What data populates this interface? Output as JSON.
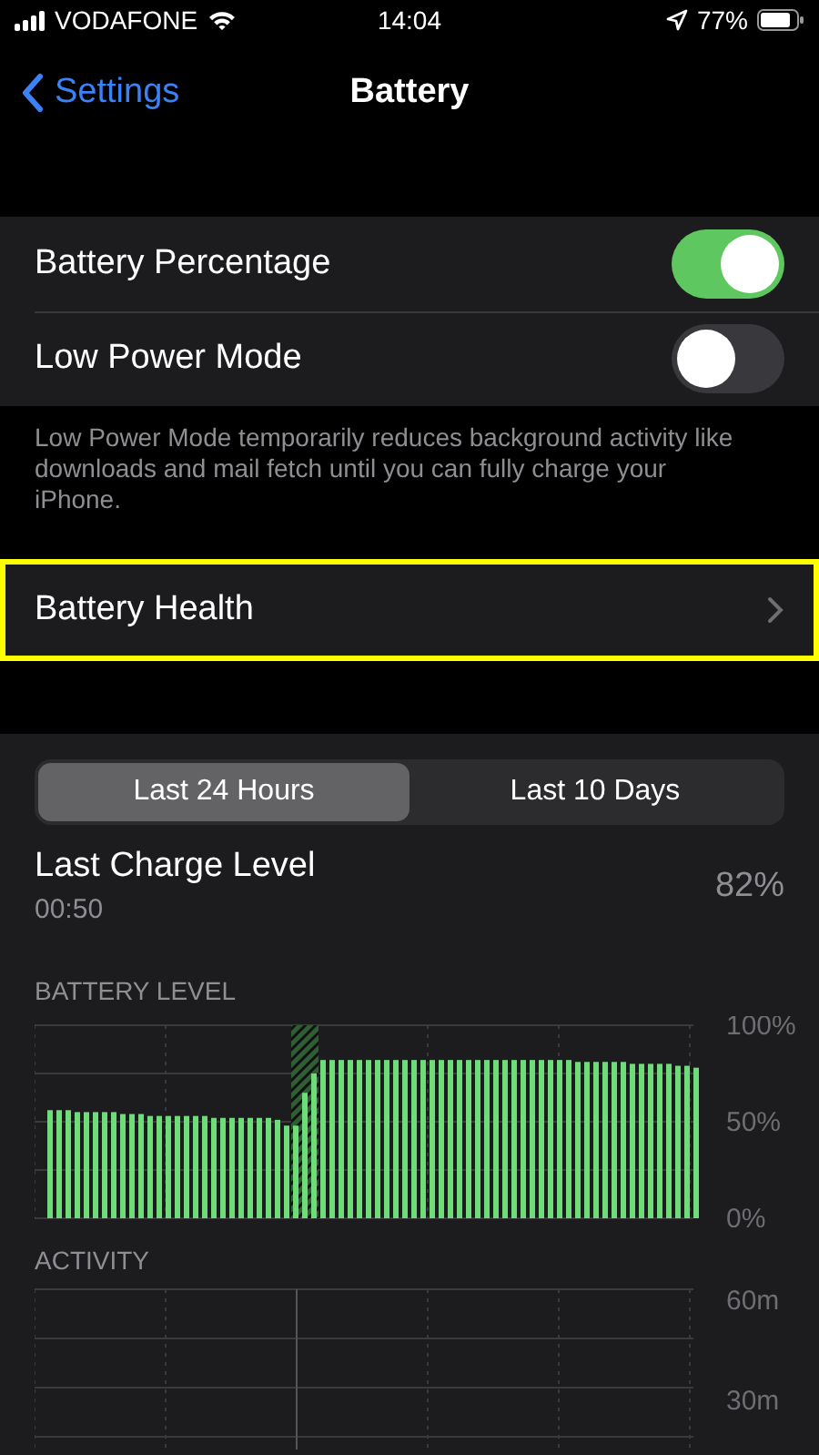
{
  "status_bar": {
    "carrier": "VODAFONE",
    "time": "14:04",
    "battery_percent": "77%"
  },
  "nav_bar": {
    "back_label": "Settings",
    "title": "Battery"
  },
  "settings_rows": [
    {
      "label": "Battery Percentage",
      "on": true
    },
    {
      "label": "Low Power Mode",
      "on": false
    }
  ],
  "settings_footer": "Low Power Mode temporarily reduces background activity like downloads and mail fetch until you can fully charge your iPhone.",
  "health_row": {
    "label": "Battery Health",
    "highlighted": true
  },
  "usage_tabs": [
    {
      "label": "Last 24 Hours",
      "selected": true
    },
    {
      "label": "Last 10 Days",
      "selected": false
    }
  ],
  "last_charge": {
    "label": "Last Charge Level",
    "time": "00:50",
    "value": "82%"
  },
  "battery_chart": {
    "chart_data": {
      "type": "bar",
      "title": "BATTERY LEVEL",
      "ylim": [
        0,
        100
      ],
      "yticks": [
        {
          "value": 100,
          "label": "100%"
        },
        {
          "value": 50,
          "label": "50%"
        },
        {
          "value": 0,
          "label": "0%"
        }
      ],
      "series": [
        {
          "color": "#6fdc7a",
          "values": [
            56,
            56,
            56,
            55,
            55,
            55,
            55,
            55,
            54,
            54,
            54,
            53,
            53,
            53,
            53,
            53,
            53,
            53,
            52,
            52,
            52,
            52,
            52,
            52,
            52,
            51,
            48,
            48,
            65,
            75,
            82,
            82,
            82,
            82,
            82,
            82,
            82,
            82,
            82,
            82,
            82,
            82,
            82,
            82,
            82,
            82,
            82,
            82,
            82,
            82,
            82,
            82,
            82,
            82,
            82,
            82,
            82,
            82,
            81,
            81,
            81,
            81,
            81,
            81,
            80,
            80,
            80,
            80,
            80,
            79,
            79,
            78
          ]
        }
      ]
    }
  },
  "activity_chart": {
    "title": "ACTIVITY",
    "axis_labels": [
      "60m",
      "30m"
    ]
  }
}
